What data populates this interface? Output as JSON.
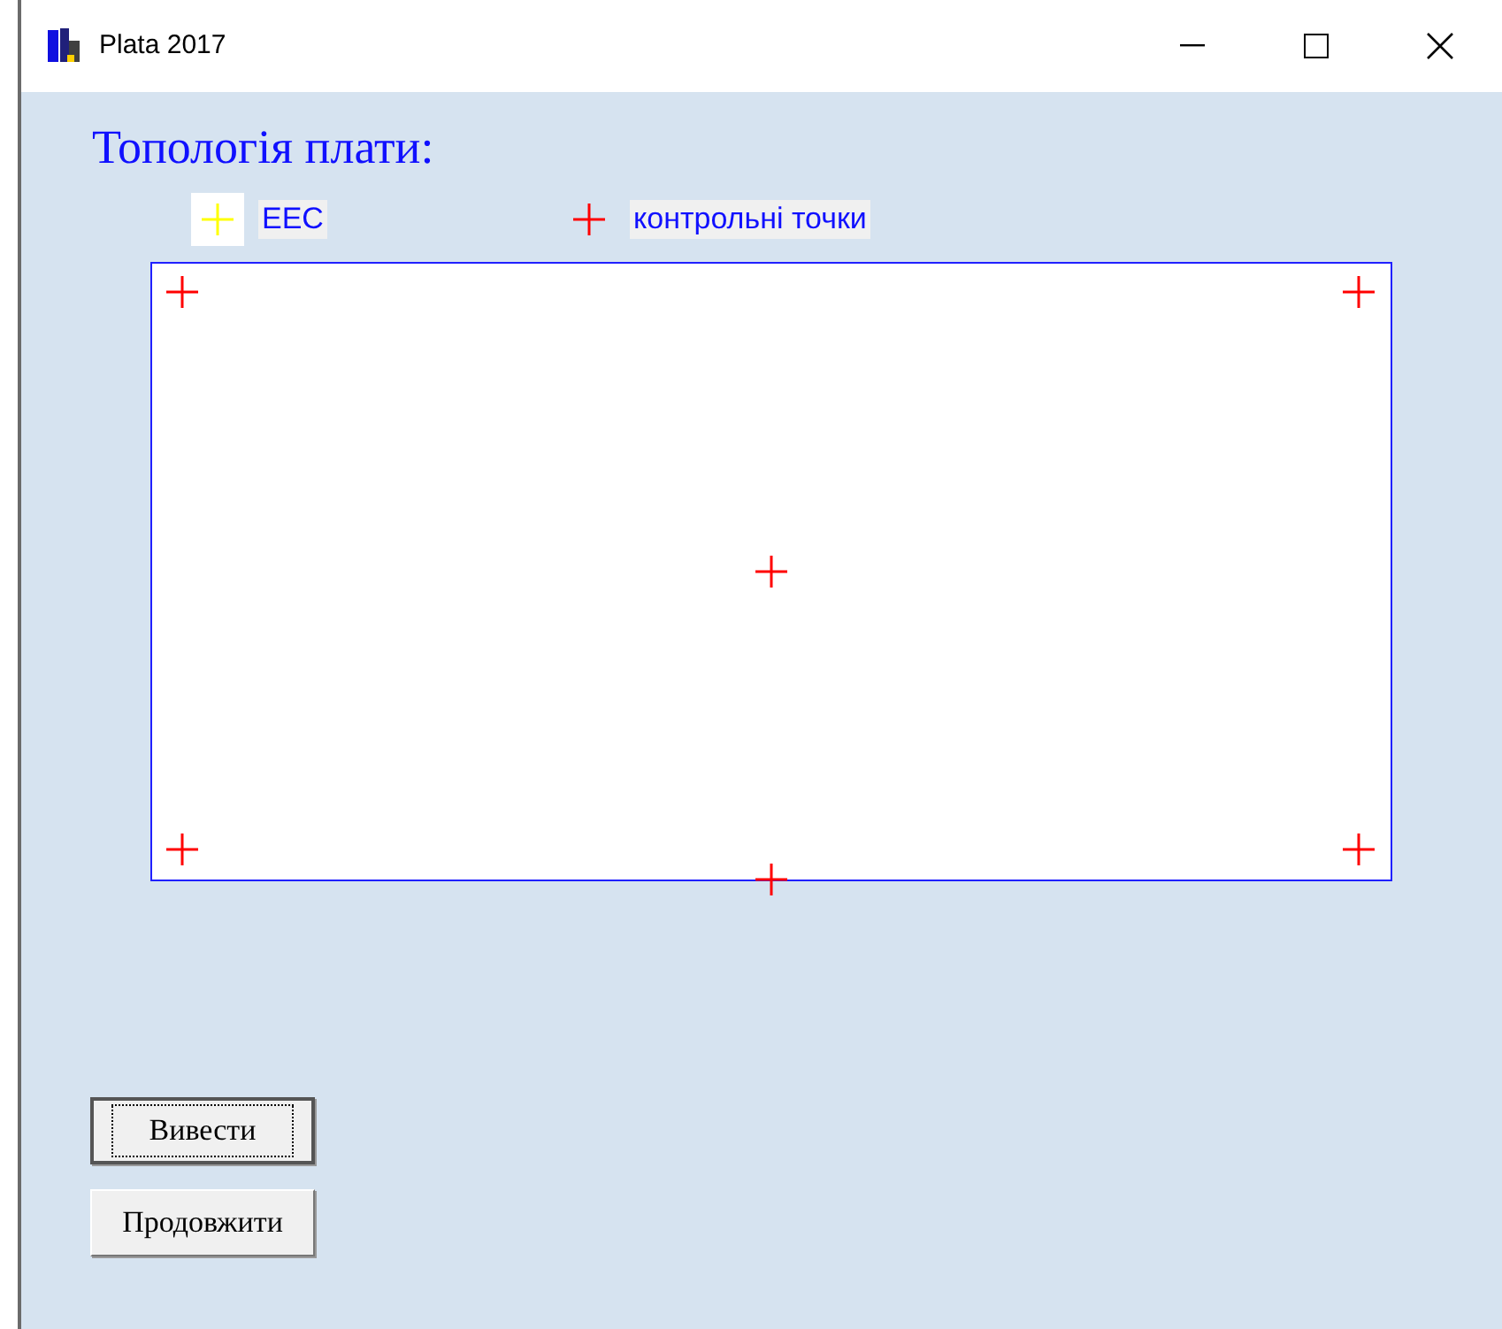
{
  "window": {
    "title": "Plata 2017"
  },
  "heading": "Топологія плати:",
  "legend": [
    {
      "label": "ЕЕС",
      "color": "#ffff00"
    },
    {
      "label": "контрольні точки",
      "color": "#ff0000"
    }
  ],
  "board": {
    "points": [
      {
        "kind": "topleft"
      },
      {
        "kind": "topright"
      },
      {
        "kind": "center"
      },
      {
        "kind": "bottomleft"
      },
      {
        "kind": "bottomcenter"
      },
      {
        "kind": "bottomright"
      }
    ]
  },
  "buttons": [
    {
      "label": "Вивести",
      "focused": true
    },
    {
      "label": "Продовжити",
      "focused": false
    }
  ]
}
